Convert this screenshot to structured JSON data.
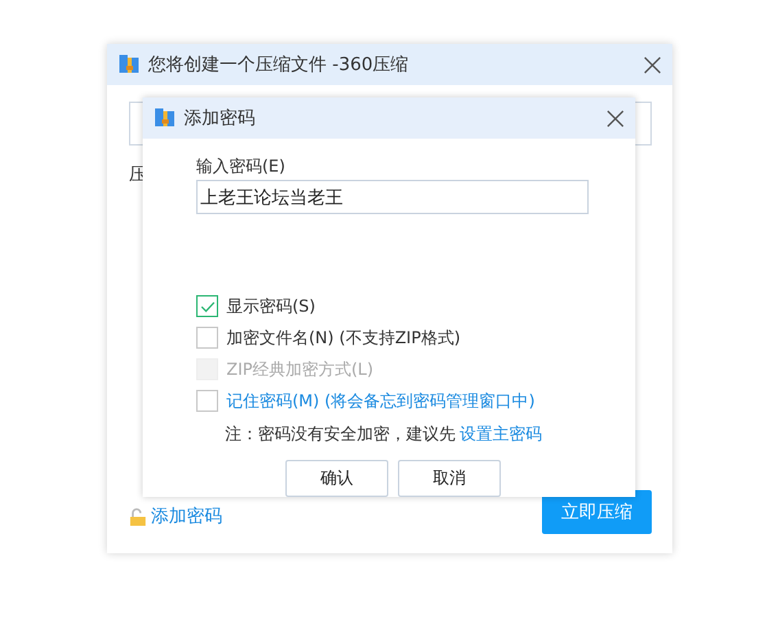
{
  "window": {
    "title": "您将创建一个压缩文件 -360压缩"
  },
  "background": {
    "label": "压",
    "add_password_link": "添加密码",
    "compress_button": "立即压缩"
  },
  "dialog": {
    "title": "添加密码",
    "password_label": "输入密码(E)",
    "password_value": "上老王论坛当老王",
    "options": [
      {
        "label": "显示密码(S)",
        "checked": true,
        "disabled": false,
        "kind": "plain"
      },
      {
        "label": "加密文件名(N) (不支持ZIP格式)",
        "checked": false,
        "disabled": false,
        "kind": "plain"
      },
      {
        "label": "ZIP经典加密方式(L)",
        "checked": false,
        "disabled": true,
        "kind": "plain"
      },
      {
        "label": "记住密码(M) (将会备忘到密码管理窗口中)",
        "checked": false,
        "disabled": false,
        "kind": "link"
      }
    ],
    "note": "注：密码没有安全加密，建议先",
    "note_link": "设置主密码",
    "buttons": [
      "确认",
      "取消"
    ]
  }
}
